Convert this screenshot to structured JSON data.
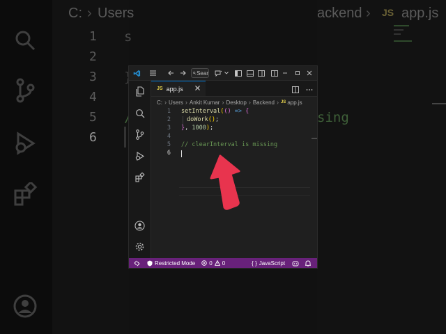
{
  "background": {
    "path_parts": [
      "C:",
      "Users",
      "ackend"
    ],
    "tab_badge": "JS",
    "tab_name": "app.js",
    "line_numbers": [
      "1",
      "2",
      "3",
      "4",
      "5",
      "6"
    ],
    "code_fragments": [
      "s",
      "}",
      "/",
      "sing"
    ]
  },
  "titlebar": {
    "search_label": "Sear"
  },
  "tab": {
    "badge": "JS",
    "name": "app.js"
  },
  "breadcrumbs": [
    "C:",
    "Users",
    "Ankit Kumar",
    "Desktop",
    "Backend",
    "app.js"
  ],
  "breadcrumb_file_badge": "JS",
  "editor": {
    "line_numbers": [
      "1",
      "2",
      "3",
      "4",
      "5",
      "6"
    ],
    "current_line": "6",
    "lines": {
      "l1_fn": "setInterval",
      "l1_open_paren": "(",
      "l1_params": "()",
      "l1_arrow": " => ",
      "l1_brace": "{",
      "l2_fn": "doWork",
      "l2_args": "()",
      "l2_semi": ";",
      "l3_brace": "}",
      "l3_sep": ", ",
      "l3_num": "1000",
      "l3_close": ")",
      "l3_semi": ";",
      "l5_comment": "// clearInterval is missing"
    }
  },
  "statusbar": {
    "restricted_mode": "Restricted Mode",
    "errors": "0",
    "warnings": "0",
    "language_braces": "{ }",
    "language": "JavaScript"
  },
  "colors": {
    "status_bar": "#68217a",
    "arrow": "#e8344e",
    "tab_accent": "#0078d4",
    "js_badge": "#e8d44d",
    "comment": "#6a9955"
  }
}
